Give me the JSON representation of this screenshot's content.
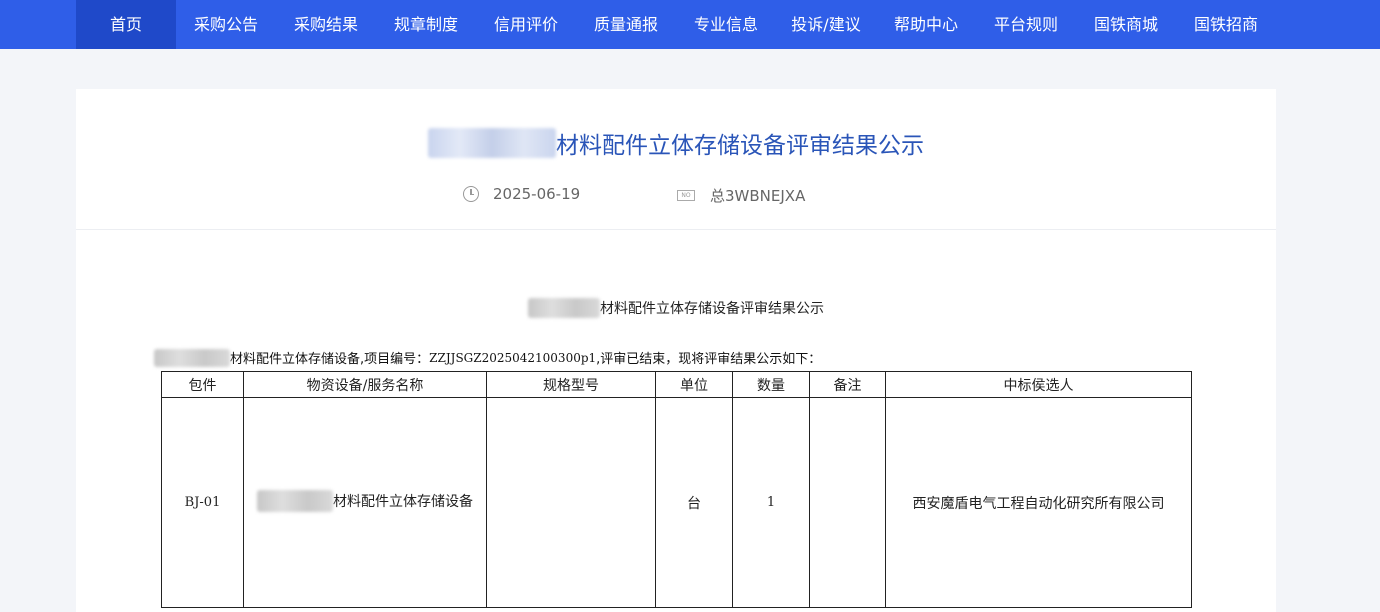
{
  "nav": {
    "items": [
      "首页",
      "采购公告",
      "采购结果",
      "规章制度",
      "信用评价",
      "质量通报",
      "专业信息",
      "投诉/建议",
      "帮助中心",
      "平台规则",
      "国铁商城",
      "国铁招商"
    ]
  },
  "header": {
    "title": "材料配件立体存储设备评审结果公示",
    "date": "2025-06-19",
    "no_badge": "NO",
    "doc_no": "总3WBNEJXA"
  },
  "doc": {
    "title": "材料配件立体存储设备评审结果公示",
    "intro_prefix": "材料配件立体存储设备,项目编号：",
    "project_no": "ZZJJSGZ2025042100300p1",
    "intro_suffix": ",评审已结束，现将评审结果公示如下："
  },
  "table": {
    "headers": [
      "包件",
      "物资设备/服务名称",
      "规格型号",
      "单位",
      "数量",
      "备注",
      "中标侯选人"
    ],
    "rows": [
      {
        "package": "BJ-01",
        "name": "材料配件立体存储设备",
        "spec": "",
        "unit": "台",
        "qty": "1",
        "remark": "",
        "candidate": "西安魔盾电气工程自动化研究所有限公司"
      }
    ]
  },
  "colors": {
    "nav_bg": "#2f5ee8",
    "nav_active": "#1f49c9",
    "title": "#2a55b8"
  }
}
